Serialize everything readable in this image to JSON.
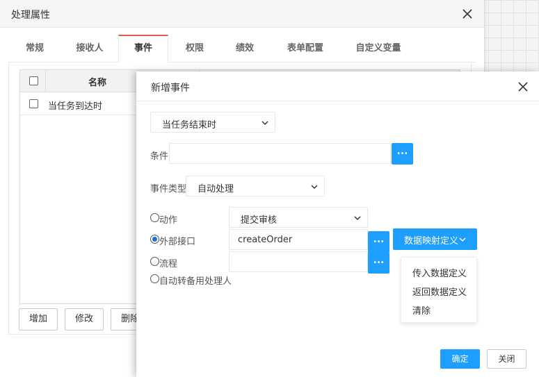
{
  "background_dialog": {
    "title": "处理属性",
    "tabs": [
      {
        "label": "常规"
      },
      {
        "label": "接收人"
      },
      {
        "label": "事件"
      },
      {
        "label": "权限"
      },
      {
        "label": "绩效"
      },
      {
        "label": "表单配置"
      },
      {
        "label": "自定义变量"
      }
    ],
    "active_tab": "事件",
    "grid": {
      "column_name": "名称",
      "rows": [
        {
          "name": "当任务到达时"
        }
      ]
    },
    "buttons": {
      "add": "增加",
      "modify": "修改",
      "delete": "删除"
    }
  },
  "event_dialog": {
    "title": "新增事件",
    "trigger_select": "当任务结束时",
    "condition_label": "条件",
    "condition_value": "",
    "dots_label": "...",
    "event_type_label": "事件类型",
    "event_type_select": "自动处理",
    "options": {
      "action": {
        "label": "动作",
        "checked": false,
        "select_value": "提交审核"
      },
      "external_api": {
        "label": "外部接口",
        "checked": true,
        "value": "createOrder"
      },
      "flow": {
        "label": "流程",
        "checked": false,
        "value": ""
      },
      "auto_transfer": {
        "label": "自动转备用处理人",
        "checked": false
      }
    },
    "mapping_button": "数据映射定义",
    "mapping_menu": [
      "传入数据定义",
      "返回数据定义",
      "清除"
    ],
    "ok": "确定",
    "close": "关闭"
  },
  "colors": {
    "primary": "#1e9fff",
    "tab_accent": "#e05a4e",
    "radio_fill": "#1e6fd9"
  }
}
